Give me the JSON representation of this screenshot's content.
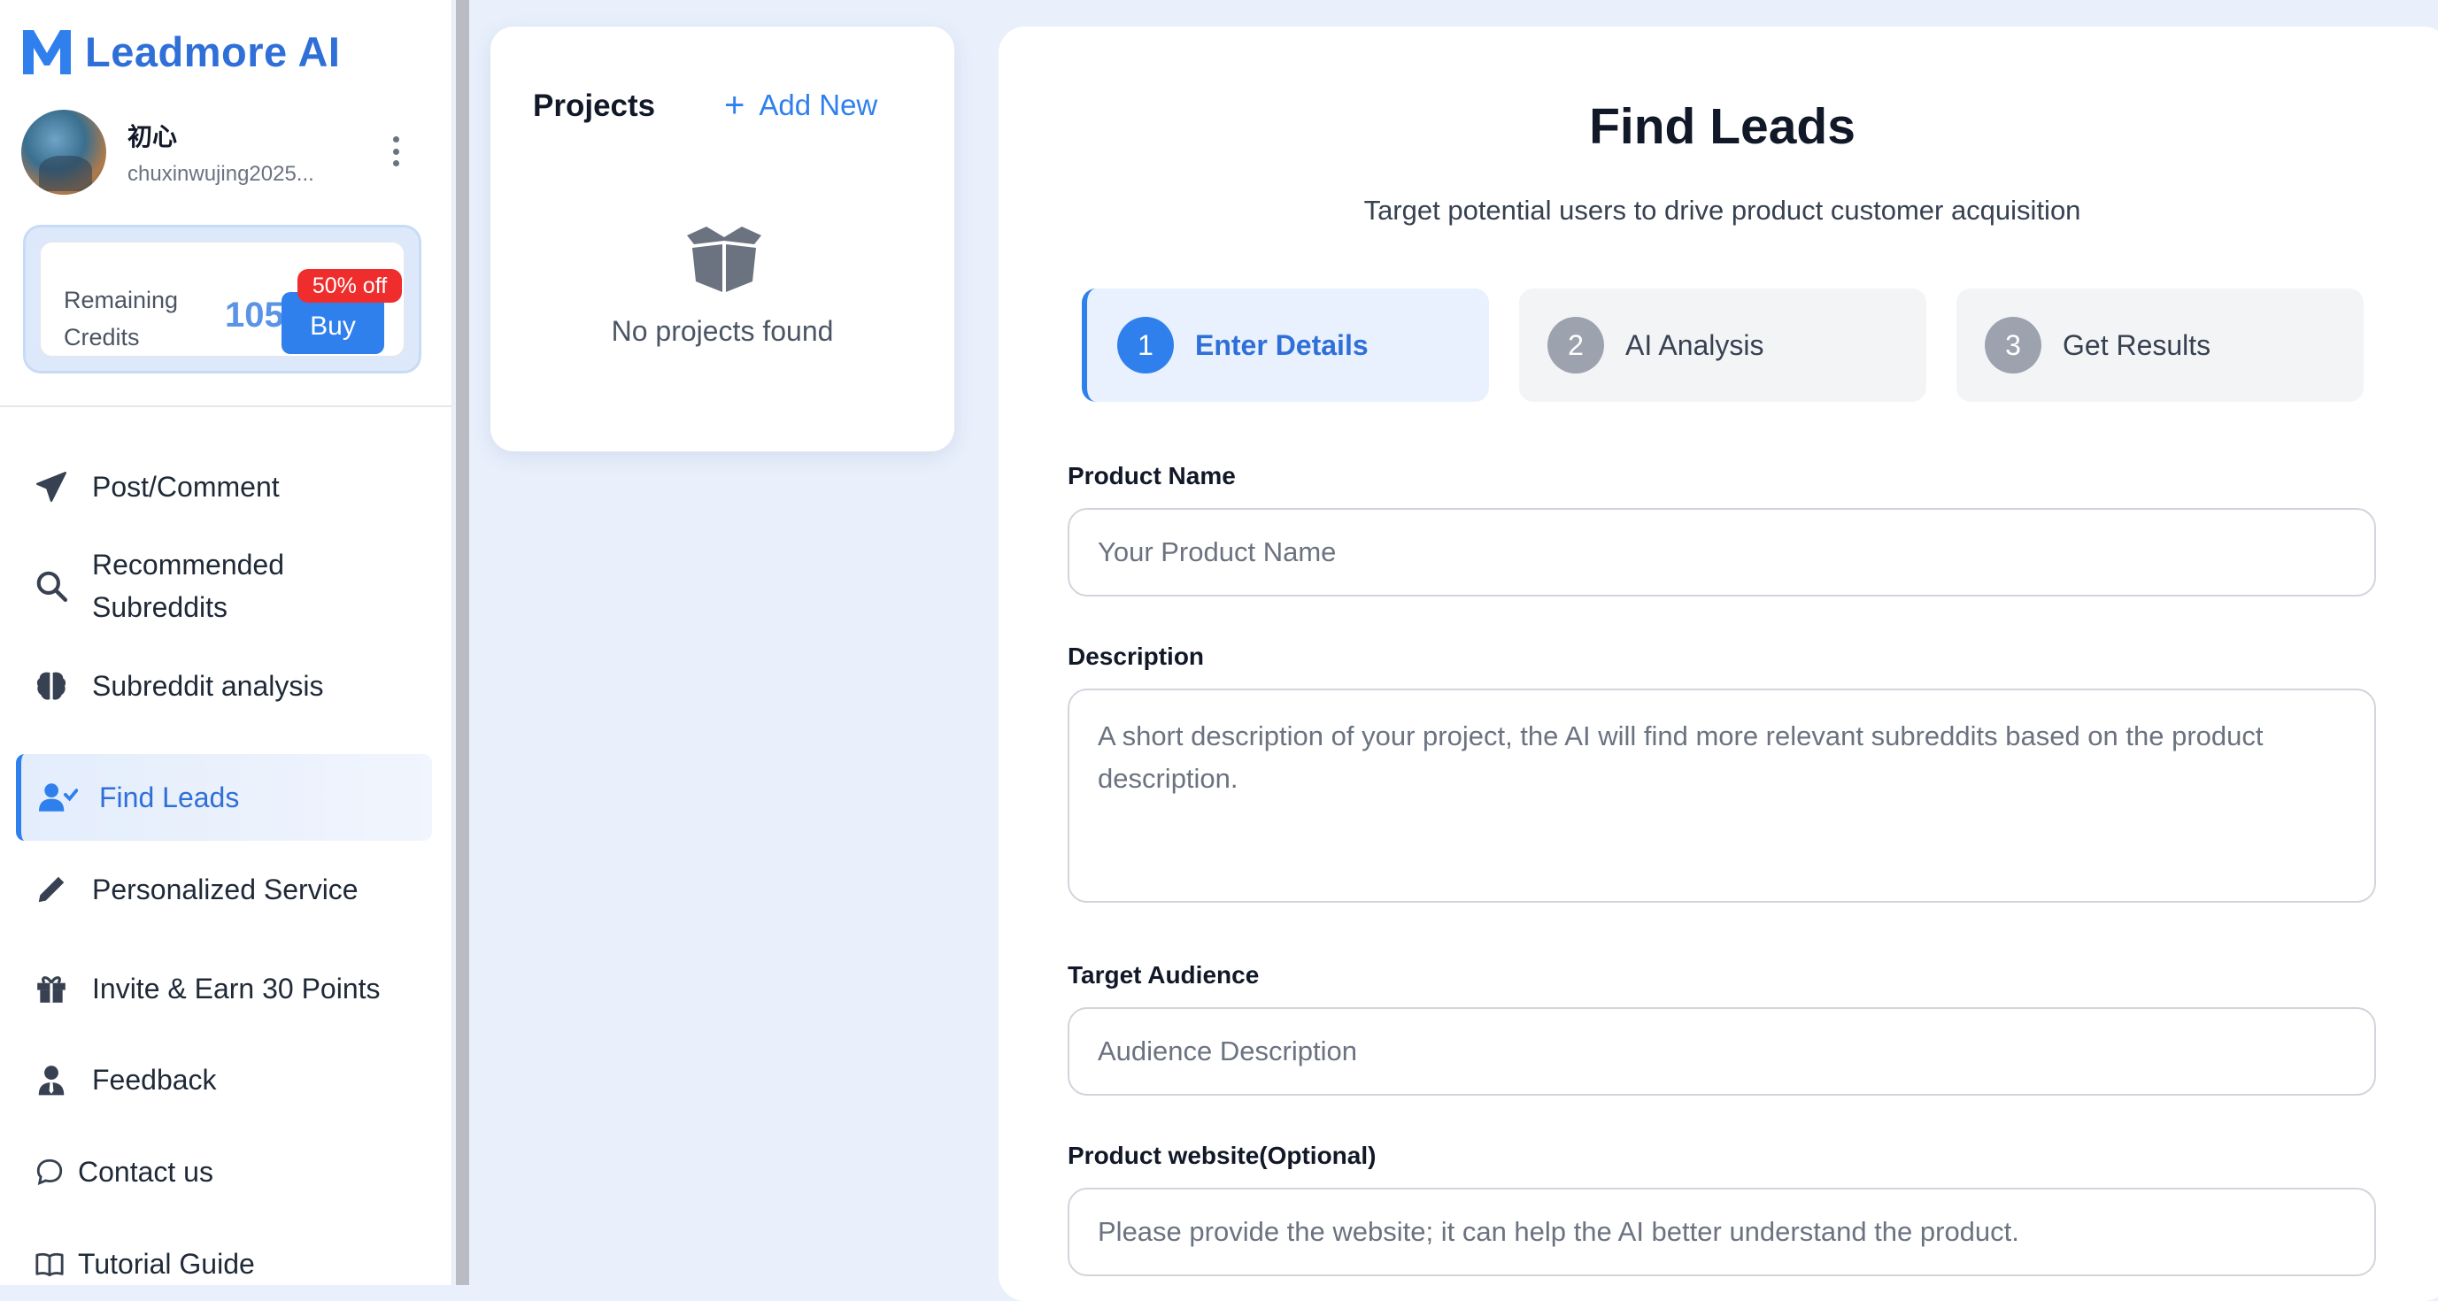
{
  "brand": {
    "name": "Leadmore AI",
    "logo_icon": "m-logo-icon",
    "color": "#2f6fd8"
  },
  "user": {
    "name": "初心",
    "email": "chuxinwujing2025..."
  },
  "credits": {
    "label": "Remaining Credits",
    "value": "105",
    "buy_label": "Buy",
    "discount": "50% off"
  },
  "sidebar": {
    "items": [
      {
        "label": "Post/Comment",
        "icon": "paper-plane-icon"
      },
      {
        "label": "Recommended Subreddits",
        "icon": "search-icon"
      },
      {
        "label": "Subreddit analysis",
        "icon": "brain-icon"
      },
      {
        "label": "Find Leads",
        "icon": "user-check-icon",
        "active": true
      },
      {
        "label": "Personalized Service",
        "icon": "pencil-icon"
      },
      {
        "label": "Invite & Earn 30 Points",
        "icon": "gift-icon"
      },
      {
        "label": "Feedback",
        "icon": "user-tie-icon"
      },
      {
        "label": "Contact us",
        "icon": "chat-bubble-icon"
      },
      {
        "label": "Tutorial Guide",
        "icon": "book-icon"
      }
    ]
  },
  "projects": {
    "title": "Projects",
    "add_label": "Add New",
    "empty_text": "No projects found"
  },
  "main": {
    "title": "Find Leads",
    "subtitle": "Target potential users to drive product customer acquisition",
    "steps": [
      {
        "num": "1",
        "label": "Enter Details"
      },
      {
        "num": "2",
        "label": "AI Analysis"
      },
      {
        "num": "3",
        "label": "Get Results"
      }
    ],
    "fields": {
      "product_name": {
        "label": "Product Name",
        "placeholder": "Your Product Name",
        "value": ""
      },
      "description": {
        "label": "Description",
        "placeholder": "A short description of your project, the AI will find more relevant subreddits based on the product description.",
        "value": ""
      },
      "target_audience": {
        "label": "Target Audience",
        "placeholder": "Audience Description",
        "value": ""
      },
      "website": {
        "label": "Product website(Optional)",
        "placeholder": "Please provide the website; it can help the AI better understand the product.",
        "value": ""
      }
    }
  },
  "colors": {
    "accent": "#2f80ed",
    "badge": "#ef2d2d",
    "background": "#e9f0fc"
  }
}
